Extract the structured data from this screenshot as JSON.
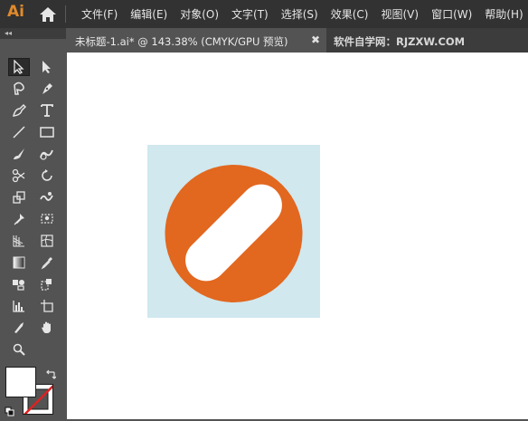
{
  "app": {
    "logo_text": "Ai",
    "home_icon": "home-icon"
  },
  "menu": {
    "items": [
      "文件(F)",
      "编辑(E)",
      "对象(O)",
      "文字(T)",
      "选择(S)",
      "效果(C)",
      "视图(V)",
      "窗口(W)",
      "帮助(H)"
    ]
  },
  "toolbox": {
    "collapse_label": "◂◂",
    "tools": [
      "selection-tool-icon",
      "direct-selection-tool-icon",
      "magic-wand-tool-icon",
      "pen-tool-icon",
      "curvature-tool-icon",
      "type-tool-icon",
      "line-segment-tool-icon",
      "rectangle-tool-icon",
      "paintbrush-tool-icon",
      "shaper-tool-icon",
      "scissors-tool-icon",
      "rotate-tool-icon",
      "scale-tool-icon",
      "warp-tool-icon",
      "puppet-warp-tool-icon",
      "free-transform-tool-icon",
      "perspective-grid-tool-icon",
      "mesh-tool-icon",
      "gradient-tool-icon",
      "eyedropper-tool-icon",
      "symbol-sprayer-tool-icon",
      "blend-tool-icon",
      "column-graph-tool-icon",
      "artboard-tool-icon",
      "slice-tool-icon",
      "hand-tool-icon",
      "zoom-tool-icon"
    ],
    "fill_color": "#ffffff",
    "stroke_color": "none"
  },
  "tabs": {
    "active_title": "未标题-1.ai* @ 143.38% (CMYK/GPU 预览)",
    "close_glyph": "✖",
    "inactive_title": "软件自学网：RJZXW.COM"
  },
  "colors": {
    "artboard_bg": "#d0e8ee",
    "circle": "#e2671f",
    "capsule": "#ffffff",
    "logo": "#e08a2b"
  }
}
